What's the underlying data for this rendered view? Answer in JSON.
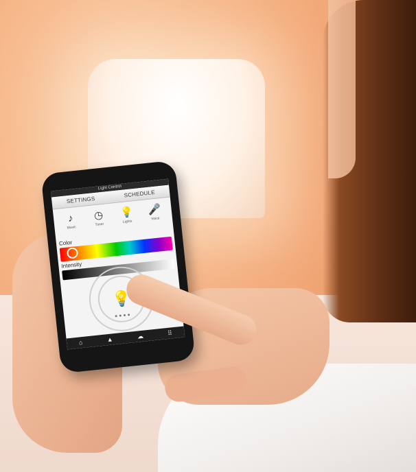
{
  "app": {
    "title": "Light Control",
    "tabs": [
      "SETTINGS",
      "SCHEDULE"
    ],
    "icons": [
      {
        "name": "music-icon",
        "label": "Music",
        "glyph": "♪"
      },
      {
        "name": "timer-icon",
        "label": "Timer",
        "glyph": "◷"
      },
      {
        "name": "lights-icon",
        "label": "Lights",
        "glyph": "💡"
      },
      {
        "name": "voice-icon",
        "label": "Voice",
        "glyph": "🎤"
      }
    ],
    "color_label": "Color",
    "intensity_label": "Intensity",
    "page_dots": "●●●●",
    "nav_icons": [
      "home-icon",
      "alert-icon",
      "cloud-icon",
      "grid-icon"
    ]
  }
}
